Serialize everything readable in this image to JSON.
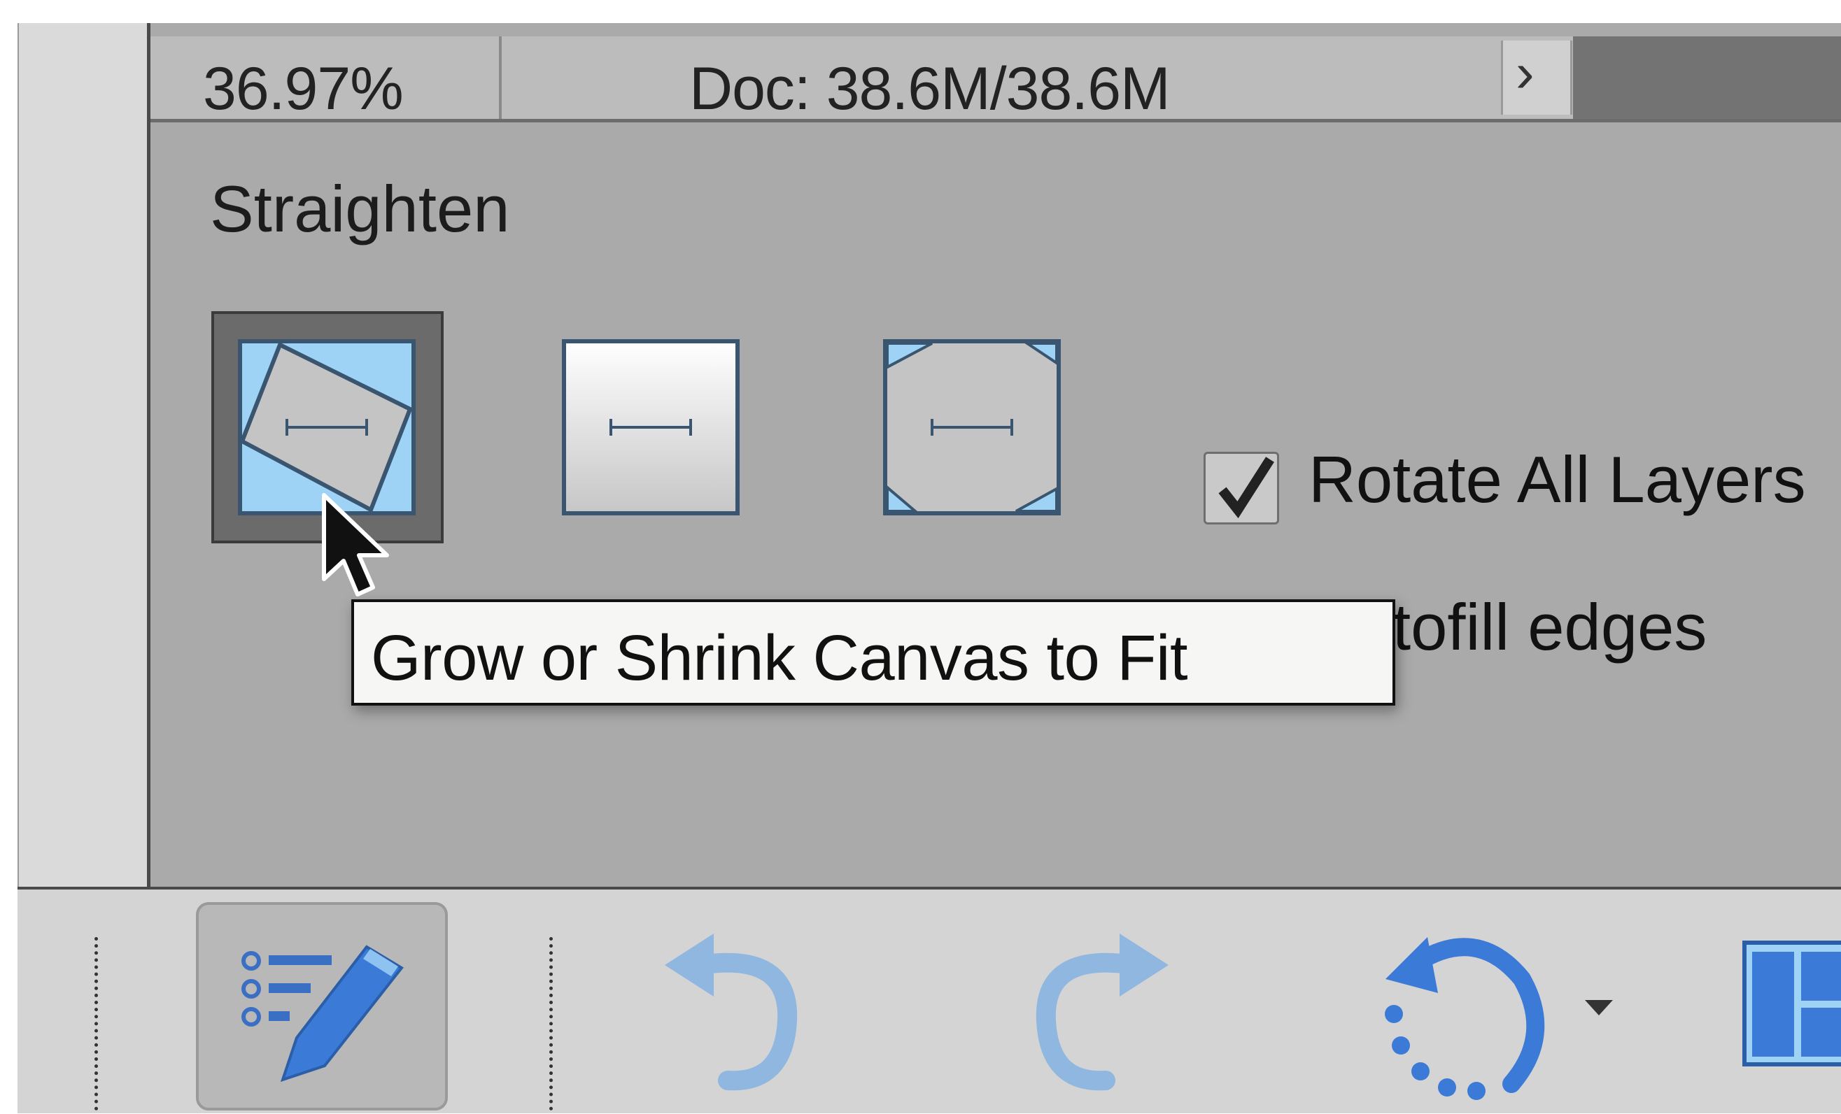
{
  "status_bar": {
    "zoom": "36.97%",
    "doc_info": "Doc: 38.6M/38.6M",
    "arrow": "›"
  },
  "options": {
    "section_title": "Straighten",
    "modes": [
      {
        "icon": "grow-or-shrink-canvas-icon",
        "selected": true
      },
      {
        "icon": "remove-background-icon",
        "selected": false
      },
      {
        "icon": "crop-to-remove-background-icon",
        "selected": false
      }
    ],
    "rotate_all_layers": {
      "label": "Rotate All Layers",
      "checked": true
    },
    "autofill_edges": {
      "visible_label": "tofill edges"
    }
  },
  "tooltip": {
    "text": "Grow or Shrink Canvas to Fit"
  },
  "toolbar": {
    "items": [
      {
        "icon": "tool-options-icon"
      },
      {
        "icon": "undo-icon"
      },
      {
        "icon": "redo-icon"
      },
      {
        "icon": "rotate-icon"
      },
      {
        "icon": "layout-icon"
      }
    ]
  },
  "colors": {
    "panel_bg": "#a9aaa9",
    "toolbar_bg": "#d4d4d4",
    "accent_blue": "#3b7ad6",
    "icon_light_blue": "#9fd3f5"
  }
}
